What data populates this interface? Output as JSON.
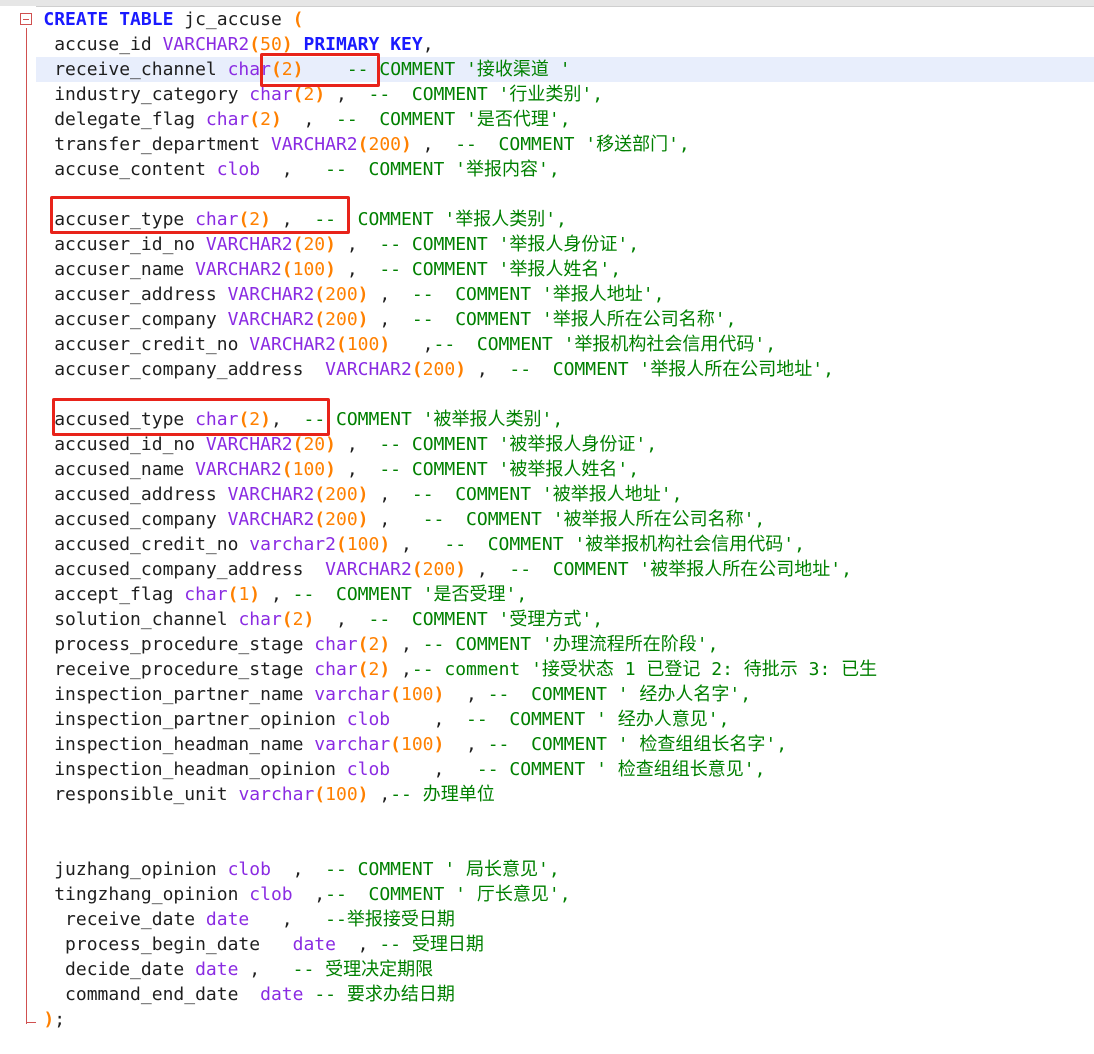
{
  "editor": {
    "lines": [
      [
        {
          "t": "kw",
          "v": "CREATE TABLE"
        },
        {
          "t": "tx",
          "v": " jc_accuse "
        },
        {
          "t": "pn",
          "v": "("
        }
      ],
      [
        {
          "t": "tx",
          "v": " accuse_id "
        },
        {
          "t": "ty",
          "v": "VARCHAR2"
        },
        {
          "t": "pn",
          "v": "("
        },
        {
          "t": "num",
          "v": "50"
        },
        {
          "t": "pn",
          "v": ")"
        },
        {
          "t": "tx",
          "v": " "
        },
        {
          "t": "kw",
          "v": "PRIMARY KEY"
        },
        {
          "t": "tx",
          "v": ","
        }
      ],
      [
        {
          "t": "tx",
          "v": " receive_channel "
        },
        {
          "t": "ty",
          "v": "char"
        },
        {
          "t": "pn",
          "v": "("
        },
        {
          "t": "num",
          "v": "2"
        },
        {
          "t": "pn",
          "v": ")"
        },
        {
          "t": "tx",
          "v": "    "
        },
        {
          "t": "cm",
          "v": "-- COMMENT '接收渠道 '"
        }
      ],
      [
        {
          "t": "tx",
          "v": " industry_category "
        },
        {
          "t": "ty",
          "v": "char"
        },
        {
          "t": "pn",
          "v": "("
        },
        {
          "t": "num",
          "v": "2"
        },
        {
          "t": "pn",
          "v": ")"
        },
        {
          "t": "tx",
          "v": " ,  "
        },
        {
          "t": "cm",
          "v": "--  COMMENT '行业类别',"
        }
      ],
      [
        {
          "t": "tx",
          "v": " delegate_flag "
        },
        {
          "t": "ty",
          "v": "char"
        },
        {
          "t": "pn",
          "v": "("
        },
        {
          "t": "num",
          "v": "2"
        },
        {
          "t": "pn",
          "v": ")"
        },
        {
          "t": "tx",
          "v": "  ,  "
        },
        {
          "t": "cm",
          "v": "--  COMMENT '是否代理',"
        }
      ],
      [
        {
          "t": "tx",
          "v": " transfer_department "
        },
        {
          "t": "ty",
          "v": "VARCHAR2"
        },
        {
          "t": "pn",
          "v": "("
        },
        {
          "t": "num",
          "v": "200"
        },
        {
          "t": "pn",
          "v": ")"
        },
        {
          "t": "tx",
          "v": " ,  "
        },
        {
          "t": "cm",
          "v": "--  COMMENT '移送部门',"
        }
      ],
      [
        {
          "t": "tx",
          "v": " accuse_content "
        },
        {
          "t": "ty",
          "v": "clob"
        },
        {
          "t": "tx",
          "v": "  ,   "
        },
        {
          "t": "cm",
          "v": "--  COMMENT '举报内容',"
        }
      ],
      [],
      [
        {
          "t": "tx",
          "v": " accuser_type "
        },
        {
          "t": "ty",
          "v": "char"
        },
        {
          "t": "pn",
          "v": "("
        },
        {
          "t": "num",
          "v": "2"
        },
        {
          "t": "pn",
          "v": ")"
        },
        {
          "t": "tx",
          "v": " ,  "
        },
        {
          "t": "cm",
          "v": "--  COMMENT '举报人类别',"
        }
      ],
      [
        {
          "t": "tx",
          "v": " accuser_id_no "
        },
        {
          "t": "ty",
          "v": "VARCHAR2"
        },
        {
          "t": "pn",
          "v": "("
        },
        {
          "t": "num",
          "v": "20"
        },
        {
          "t": "pn",
          "v": ")"
        },
        {
          "t": "tx",
          "v": " ,  "
        },
        {
          "t": "cm",
          "v": "-- COMMENT '举报人身份证',"
        }
      ],
      [
        {
          "t": "tx",
          "v": " accuser_name "
        },
        {
          "t": "ty",
          "v": "VARCHAR2"
        },
        {
          "t": "pn",
          "v": "("
        },
        {
          "t": "num",
          "v": "100"
        },
        {
          "t": "pn",
          "v": ")"
        },
        {
          "t": "tx",
          "v": " ,  "
        },
        {
          "t": "cm",
          "v": "-- COMMENT '举报人姓名',"
        }
      ],
      [
        {
          "t": "tx",
          "v": " accuser_address "
        },
        {
          "t": "ty",
          "v": "VARCHAR2"
        },
        {
          "t": "pn",
          "v": "("
        },
        {
          "t": "num",
          "v": "200"
        },
        {
          "t": "pn",
          "v": ")"
        },
        {
          "t": "tx",
          "v": " ,  "
        },
        {
          "t": "cm",
          "v": "--  COMMENT '举报人地址',"
        }
      ],
      [
        {
          "t": "tx",
          "v": " accuser_company "
        },
        {
          "t": "ty",
          "v": "VARCHAR2"
        },
        {
          "t": "pn",
          "v": "("
        },
        {
          "t": "num",
          "v": "200"
        },
        {
          "t": "pn",
          "v": ")"
        },
        {
          "t": "tx",
          "v": " ,  "
        },
        {
          "t": "cm",
          "v": "--  COMMENT '举报人所在公司名称',"
        }
      ],
      [
        {
          "t": "tx",
          "v": " accuser_credit_no "
        },
        {
          "t": "ty",
          "v": "VARCHAR2"
        },
        {
          "t": "pn",
          "v": "("
        },
        {
          "t": "num",
          "v": "100"
        },
        {
          "t": "pn",
          "v": ")"
        },
        {
          "t": "tx",
          "v": "   ,"
        },
        {
          "t": "cm",
          "v": "--  COMMENT '举报机构社会信用代码',"
        }
      ],
      [
        {
          "t": "tx",
          "v": " accuser_company_address  "
        },
        {
          "t": "ty",
          "v": "VARCHAR2"
        },
        {
          "t": "pn",
          "v": "("
        },
        {
          "t": "num",
          "v": "200"
        },
        {
          "t": "pn",
          "v": ")"
        },
        {
          "t": "tx",
          "v": " ,  "
        },
        {
          "t": "cm",
          "v": "--  COMMENT '举报人所在公司地址',"
        }
      ],
      [],
      [
        {
          "t": "tx",
          "v": " accused_type "
        },
        {
          "t": "ty",
          "v": "char"
        },
        {
          "t": "pn",
          "v": "("
        },
        {
          "t": "num",
          "v": "2"
        },
        {
          "t": "pn",
          "v": ")"
        },
        {
          "t": "tx",
          "v": ",  "
        },
        {
          "t": "cm",
          "v": "-- COMMENT '被举报人类别',"
        }
      ],
      [
        {
          "t": "tx",
          "v": " accused_id_no "
        },
        {
          "t": "ty",
          "v": "VARCHAR2"
        },
        {
          "t": "pn",
          "v": "("
        },
        {
          "t": "num",
          "v": "20"
        },
        {
          "t": "pn",
          "v": ")"
        },
        {
          "t": "tx",
          "v": " ,  "
        },
        {
          "t": "cm",
          "v": "-- COMMENT '被举报人身份证',"
        }
      ],
      [
        {
          "t": "tx",
          "v": " accused_name "
        },
        {
          "t": "ty",
          "v": "VARCHAR2"
        },
        {
          "t": "pn",
          "v": "("
        },
        {
          "t": "num",
          "v": "100"
        },
        {
          "t": "pn",
          "v": ")"
        },
        {
          "t": "tx",
          "v": " ,  "
        },
        {
          "t": "cm",
          "v": "-- COMMENT '被举报人姓名',"
        }
      ],
      [
        {
          "t": "tx",
          "v": " accused_address "
        },
        {
          "t": "ty",
          "v": "VARCHAR2"
        },
        {
          "t": "pn",
          "v": "("
        },
        {
          "t": "num",
          "v": "200"
        },
        {
          "t": "pn",
          "v": ")"
        },
        {
          "t": "tx",
          "v": " ,  "
        },
        {
          "t": "cm",
          "v": "--  COMMENT '被举报人地址',"
        }
      ],
      [
        {
          "t": "tx",
          "v": " accused_company "
        },
        {
          "t": "ty",
          "v": "VARCHAR2"
        },
        {
          "t": "pn",
          "v": "("
        },
        {
          "t": "num",
          "v": "200"
        },
        {
          "t": "pn",
          "v": ")"
        },
        {
          "t": "tx",
          "v": " ,   "
        },
        {
          "t": "cm",
          "v": "--  COMMENT '被举报人所在公司名称',"
        }
      ],
      [
        {
          "t": "tx",
          "v": " accused_credit_no "
        },
        {
          "t": "ty",
          "v": "varchar2"
        },
        {
          "t": "pn",
          "v": "("
        },
        {
          "t": "num",
          "v": "100"
        },
        {
          "t": "pn",
          "v": ")"
        },
        {
          "t": "tx",
          "v": " ,   "
        },
        {
          "t": "cm",
          "v": "--  COMMENT '被举报机构社会信用代码',"
        }
      ],
      [
        {
          "t": "tx",
          "v": " accused_company_address  "
        },
        {
          "t": "ty",
          "v": "VARCHAR2"
        },
        {
          "t": "pn",
          "v": "("
        },
        {
          "t": "num",
          "v": "200"
        },
        {
          "t": "pn",
          "v": ")"
        },
        {
          "t": "tx",
          "v": " ,  "
        },
        {
          "t": "cm",
          "v": "--  COMMENT '被举报人所在公司地址',"
        }
      ],
      [
        {
          "t": "tx",
          "v": " accept_flag "
        },
        {
          "t": "ty",
          "v": "char"
        },
        {
          "t": "pn",
          "v": "("
        },
        {
          "t": "num",
          "v": "1"
        },
        {
          "t": "pn",
          "v": ")"
        },
        {
          "t": "tx",
          "v": " , "
        },
        {
          "t": "cm",
          "v": "--  COMMENT '是否受理',"
        }
      ],
      [
        {
          "t": "tx",
          "v": " solution_channel "
        },
        {
          "t": "ty",
          "v": "char"
        },
        {
          "t": "pn",
          "v": "("
        },
        {
          "t": "num",
          "v": "2"
        },
        {
          "t": "pn",
          "v": ")"
        },
        {
          "t": "tx",
          "v": "  ,  "
        },
        {
          "t": "cm",
          "v": "--  COMMENT '受理方式',"
        }
      ],
      [
        {
          "t": "tx",
          "v": " process_procedure_stage "
        },
        {
          "t": "ty",
          "v": "char"
        },
        {
          "t": "pn",
          "v": "("
        },
        {
          "t": "num",
          "v": "2"
        },
        {
          "t": "pn",
          "v": ")"
        },
        {
          "t": "tx",
          "v": " , "
        },
        {
          "t": "cm",
          "v": "-- COMMENT '办理流程所在阶段',"
        }
      ],
      [
        {
          "t": "tx",
          "v": " receive_procedure_stage "
        },
        {
          "t": "ty",
          "v": "char"
        },
        {
          "t": "pn",
          "v": "("
        },
        {
          "t": "num",
          "v": "2"
        },
        {
          "t": "pn",
          "v": ")"
        },
        {
          "t": "tx",
          "v": " ,"
        },
        {
          "t": "cm",
          "v": "-- comment '接受状态 1 已登记 2: 待批示 3: 已生"
        }
      ],
      [
        {
          "t": "tx",
          "v": " inspection_partner_name "
        },
        {
          "t": "ty",
          "v": "varchar"
        },
        {
          "t": "pn",
          "v": "("
        },
        {
          "t": "num",
          "v": "100"
        },
        {
          "t": "pn",
          "v": ")"
        },
        {
          "t": "tx",
          "v": "  , "
        },
        {
          "t": "cm",
          "v": "--  COMMENT ' 经办人名字',"
        }
      ],
      [
        {
          "t": "tx",
          "v": " inspection_partner_opinion "
        },
        {
          "t": "ty",
          "v": "clob"
        },
        {
          "t": "tx",
          "v": "    ,  "
        },
        {
          "t": "cm",
          "v": "--  COMMENT ' 经办人意见',"
        }
      ],
      [
        {
          "t": "tx",
          "v": " inspection_headman_name "
        },
        {
          "t": "ty",
          "v": "varchar"
        },
        {
          "t": "pn",
          "v": "("
        },
        {
          "t": "num",
          "v": "100"
        },
        {
          "t": "pn",
          "v": ")"
        },
        {
          "t": "tx",
          "v": "  , "
        },
        {
          "t": "cm",
          "v": "--  COMMENT ' 检查组组长名字',"
        }
      ],
      [
        {
          "t": "tx",
          "v": " inspection_headman_opinion "
        },
        {
          "t": "ty",
          "v": "clob"
        },
        {
          "t": "tx",
          "v": "    ,   "
        },
        {
          "t": "cm",
          "v": "-- COMMENT ' 检查组组长意见',"
        }
      ],
      [
        {
          "t": "tx",
          "v": " responsible_unit "
        },
        {
          "t": "ty",
          "v": "varchar"
        },
        {
          "t": "pn",
          "v": "("
        },
        {
          "t": "num",
          "v": "100"
        },
        {
          "t": "pn",
          "v": ")"
        },
        {
          "t": "tx",
          "v": " ,"
        },
        {
          "t": "cm",
          "v": "-- 办理单位"
        }
      ],
      [],
      [],
      [
        {
          "t": "tx",
          "v": " juzhang_opinion "
        },
        {
          "t": "ty",
          "v": "clob"
        },
        {
          "t": "tx",
          "v": "  ,  "
        },
        {
          "t": "cm",
          "v": "-- COMMENT ' 局长意见',"
        }
      ],
      [
        {
          "t": "tx",
          "v": " tingzhang_opinion "
        },
        {
          "t": "ty",
          "v": "clob"
        },
        {
          "t": "tx",
          "v": "  ,"
        },
        {
          "t": "cm",
          "v": "--  COMMENT ' 厅长意见',"
        }
      ],
      [
        {
          "t": "tx",
          "v": "  receive_date "
        },
        {
          "t": "ty",
          "v": "date"
        },
        {
          "t": "tx",
          "v": "   ,   "
        },
        {
          "t": "cm",
          "v": "--举报接受日期"
        }
      ],
      [
        {
          "t": "tx",
          "v": "  process_begin_date   "
        },
        {
          "t": "ty",
          "v": "date"
        },
        {
          "t": "tx",
          "v": "  , "
        },
        {
          "t": "cm",
          "v": "-- 受理日期"
        }
      ],
      [
        {
          "t": "tx",
          "v": "  decide_date "
        },
        {
          "t": "ty",
          "v": "date"
        },
        {
          "t": "tx",
          "v": " ,   "
        },
        {
          "t": "cm",
          "v": "-- 受理决定期限"
        }
      ],
      [
        {
          "t": "tx",
          "v": "  command_end_date  "
        },
        {
          "t": "ty",
          "v": "date"
        },
        {
          "t": "tx",
          "v": " "
        },
        {
          "t": "cm",
          "v": "-- 要求办结日期"
        }
      ],
      [
        {
          "t": "pn",
          "v": ")"
        },
        {
          "t": "tx",
          "v": ";"
        }
      ]
    ]
  }
}
